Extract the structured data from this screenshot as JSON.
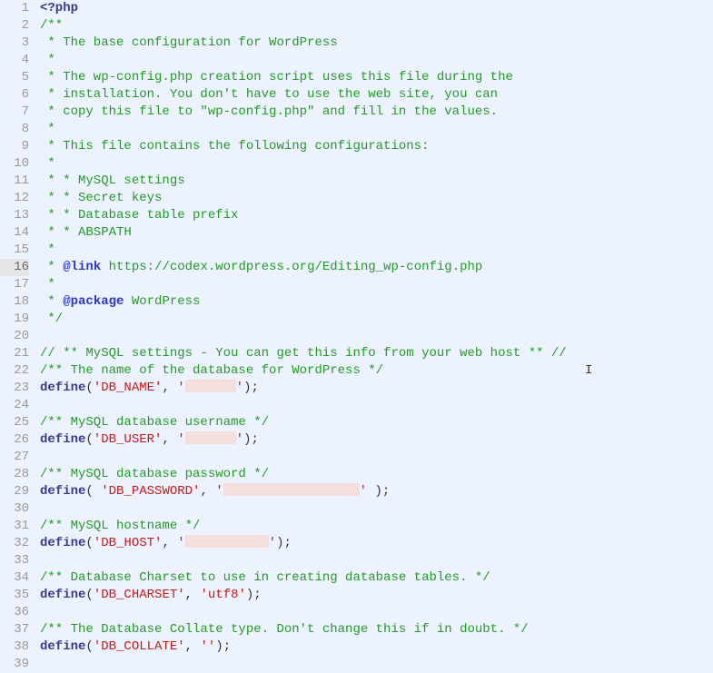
{
  "gutter": {
    "start": 1,
    "end": 39,
    "current": 16
  },
  "code": {
    "l1_open": "<?php",
    "l2": "/**",
    "l3": " * The base configuration for WordPress",
    "l4": " *",
    "l5": " * The wp-config.php creation script uses this file during the",
    "l6": " * installation. You don't have to use the web site, you can",
    "l7": " * copy this file to \"wp-config.php\" and fill in the values.",
    "l8": " *",
    "l9": " * This file contains the following configurations:",
    "l10": " *",
    "l11": " * * MySQL settings",
    "l12": " * * Secret keys",
    "l13": " * * Database table prefix",
    "l14": " * * ABSPATH",
    "l15": " *",
    "l16_pre": " * ",
    "l16_tag": "@link",
    "l16_post": " https://codex.wordpress.org/Editing_wp-config.php",
    "l17": " *",
    "l18_pre": " * ",
    "l18_tag": "@package",
    "l18_post": " WordPress",
    "l19": " */",
    "l21": "// ** MySQL settings - You can get this info from your web host ** //",
    "l22": "/** The name of the database for WordPress */",
    "l23_fn": "define",
    "l23_s1": "'DB_NAME'",
    "l25": "/** MySQL database username */",
    "l26_s1": "'DB_USER'",
    "l28": "/** MySQL database password */",
    "l29_s1": "'DB_PASSWORD'",
    "l31": "/** MySQL hostname */",
    "l32_s1": "'DB_HOST'",
    "l34": "/** Database Charset to use in creating database tables. */",
    "l35_s1": "'DB_CHARSET'",
    "l35_s2": "'utf8'",
    "l37": "/** The Database Collate type. Don't change this if in doubt. */",
    "l38_s1": "'DB_COLLATE'",
    "l38_s2": "''",
    "comma": ", ",
    "commaSp": ",  ",
    "sq": "'",
    "op": "(",
    "opSp": "( ",
    "cp": ")",
    "cpSp": " )",
    "semi": ";"
  }
}
